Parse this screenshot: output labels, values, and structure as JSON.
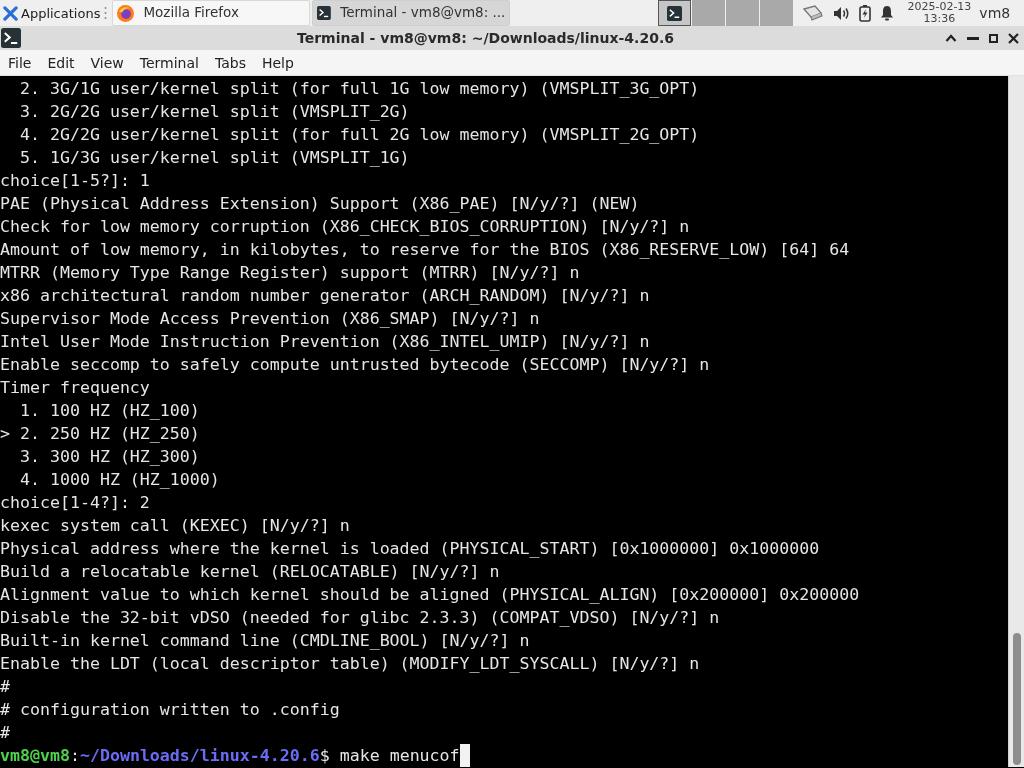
{
  "panel": {
    "apps_menu": "Applications",
    "tasks": [
      {
        "label": "Mozilla Firefox",
        "kind": "browser",
        "selected": false
      },
      {
        "label": "Terminal - vm8@vm8: ...",
        "kind": "terminal",
        "selected": true
      }
    ],
    "workspaces": [
      {
        "kind": "terminal",
        "selected": true
      },
      {
        "kind": "empty",
        "selected": false
      },
      {
        "kind": "empty",
        "selected": false
      },
      {
        "kind": "empty",
        "selected": false
      }
    ],
    "clock": {
      "date": "2025-02-13",
      "time": "13:36"
    },
    "user": "vm8"
  },
  "window": {
    "title": "Terminal - vm8@vm8: ~/Downloads/linux-4.20.6"
  },
  "menu": [
    "File",
    "Edit",
    "View",
    "Terminal",
    "Tabs",
    "Help"
  ],
  "terminal": {
    "lines": [
      "  2. 3G/1G user/kernel split (for full 1G low memory) (VMSPLIT_3G_OPT)",
      "  3. 2G/2G user/kernel split (VMSPLIT_2G)",
      "  4. 2G/2G user/kernel split (for full 2G low memory) (VMSPLIT_2G_OPT)",
      "  5. 1G/3G user/kernel split (VMSPLIT_1G)",
      "choice[1-5?]: 1",
      "PAE (Physical Address Extension) Support (X86_PAE) [N/y/?] (NEW)",
      "Check for low memory corruption (X86_CHECK_BIOS_CORRUPTION) [N/y/?] n",
      "Amount of low memory, in kilobytes, to reserve for the BIOS (X86_RESERVE_LOW) [64] 64",
      "MTRR (Memory Type Range Register) support (MTRR) [N/y/?] n",
      "x86 architectural random number generator (ARCH_RANDOM) [N/y/?] n",
      "Supervisor Mode Access Prevention (X86_SMAP) [N/y/?] n",
      "Intel User Mode Instruction Prevention (X86_INTEL_UMIP) [N/y/?] n",
      "Enable seccomp to safely compute untrusted bytecode (SECCOMP) [N/y/?] n",
      "Timer frequency",
      "  1. 100 HZ (HZ_100)",
      "> 2. 250 HZ (HZ_250)",
      "  3. 300 HZ (HZ_300)",
      "  4. 1000 HZ (HZ_1000)",
      "choice[1-4?]: 2",
      "kexec system call (KEXEC) [N/y/?] n",
      "Physical address where the kernel is loaded (PHYSICAL_START) [0x1000000] 0x1000000",
      "Build a relocatable kernel (RELOCATABLE) [N/y/?] n",
      "Alignment value to which kernel should be aligned (PHYSICAL_ALIGN) [0x200000] 0x200000",
      "Disable the 32-bit vDSO (needed for glibc 2.3.3) (COMPAT_VDSO) [N/y/?] n",
      "Built-in kernel command line (CMDLINE_BOOL) [N/y/?] n",
      "Enable the LDT (local descriptor table) (MODIFY_LDT_SYSCALL) [N/y/?] n",
      "#",
      "# configuration written to .config",
      "#"
    ],
    "prompt": {
      "user_host": "vm8@vm8",
      "separator": ":",
      "path": "~/Downloads/linux-4.20.6",
      "symbol": "$",
      "command": "make menucof"
    }
  }
}
